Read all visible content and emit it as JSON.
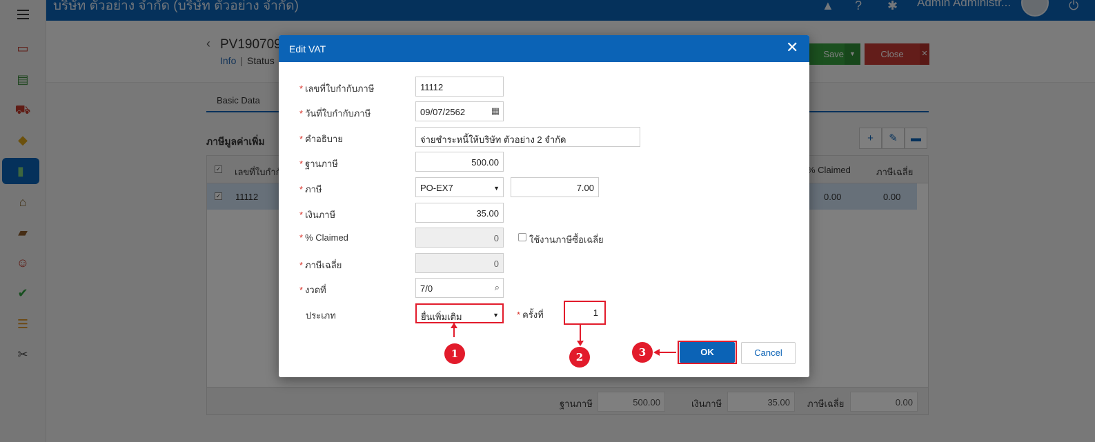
{
  "app": {
    "company": "บริษัท ตัวอย่าง จำกัด (บริษัท ตัวอย่าง จำกัด)",
    "user": "Admin Administr...",
    "doc_title": "PV190709",
    "link_info": "Info",
    "link_status": "Status",
    "save_label": "Save",
    "close_label": "Close",
    "tab_basic": "Basic Data",
    "section_title": "ภาษีมูลค่าเพิ่ม",
    "sidebar_icons": [
      "card-icon",
      "money-icon",
      "cart-icon",
      "box-icon",
      "book-icon",
      "bank-icon",
      "wallet-icon",
      "person-icon",
      "check-icon",
      "report-icon",
      "tools-icon"
    ],
    "colors": {
      "primary": "#0b63b6",
      "save": "#37a03f",
      "close": "#c63a35",
      "annotation": "#e21b2b"
    }
  },
  "grid": {
    "headers": [
      "เลขที่ใบกำกับ",
      "% Claimed",
      "ภาษีเฉลี่ย"
    ],
    "row": {
      "doc_no": "11112",
      "claimed": "0.00",
      "avg_tax": "0.00"
    }
  },
  "footer": {
    "tax_base_label": "ฐานภาษี",
    "tax_base_value": "500.00",
    "tax_amount_label": "เงินภาษี",
    "tax_amount_value": "35.00",
    "avg_tax_label": "ภาษีเฉลี่ย",
    "avg_tax_value": "0.00"
  },
  "modal": {
    "title": "Edit VAT",
    "fields": {
      "invoice_no": {
        "label": "เลขที่ใบกำกับภาษี",
        "value": "11112"
      },
      "invoice_date": {
        "label": "วันที่ใบกำกับภาษี",
        "value": "09/07/2562"
      },
      "description": {
        "label": "คำอธิบาย",
        "value": "จ่ายชำระหนี้ให้บริษัท ตัวอย่าง 2 จำกัด"
      },
      "tax_base": {
        "label": "ฐานภาษี",
        "value": "500.00"
      },
      "tax": {
        "label": "ภาษี",
        "code": "PO-EX7",
        "rate": "7.00"
      },
      "tax_amount": {
        "label": "เงินภาษี",
        "value": "35.00"
      },
      "claimed": {
        "label": "% Claimed",
        "value": "0",
        "checkbox_label": "ใช้งานภาษีซื้อเฉลี่ย"
      },
      "avg_tax": {
        "label": "ภาษีเฉลี่ย",
        "value": "0"
      },
      "period": {
        "label": "งวดที่",
        "value": "7/0"
      },
      "type": {
        "label": "ประเภท",
        "value": "ยื่นเพิ่มเติม"
      },
      "times": {
        "label": "ครั้งที่",
        "value": "1"
      }
    },
    "ok_label": "OK",
    "cancel_label": "Cancel"
  },
  "annotations": [
    "1",
    "2",
    "3"
  ]
}
